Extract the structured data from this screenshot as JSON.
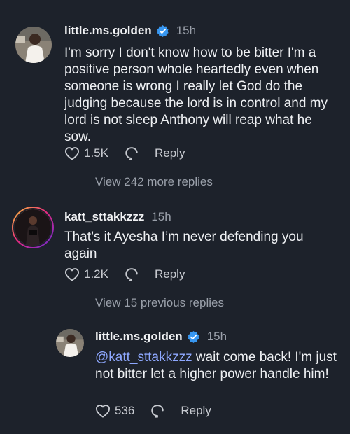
{
  "comments": [
    {
      "username": "little.ms.golden",
      "verified": true,
      "time": "15h",
      "text": "I'm sorry I don't know how to be bitter I'm a positive person whole heartedly even when someone is wrong I really let God do the judging because the lord is in control and my lord is not sleep Anthony will reap what he sow.",
      "likes": "1.5K",
      "reply_label": "Reply",
      "view_replies": "View 242 more replies"
    },
    {
      "username": "katt_sttakkzzz",
      "verified": false,
      "time": "15h",
      "text": "That’s it Ayesha I’m never defending you again",
      "likes": "1.2K",
      "reply_label": "Reply",
      "view_replies": "View 15 previous replies"
    },
    {
      "username": "little.ms.golden",
      "verified": true,
      "time": "15h",
      "mention": "@katt_sttakkzzz",
      "text": " wait come back! I'm just not bitter let a higher power handle him!",
      "likes": "536",
      "reply_label": "Reply"
    }
  ],
  "icons": {
    "like": "heart-icon",
    "reply": "comment-bubble-icon",
    "verified": "verified-badge-icon"
  },
  "colors": {
    "background": "#1d222b",
    "mention": "#8ea8ff",
    "verified": "#3897f0"
  }
}
